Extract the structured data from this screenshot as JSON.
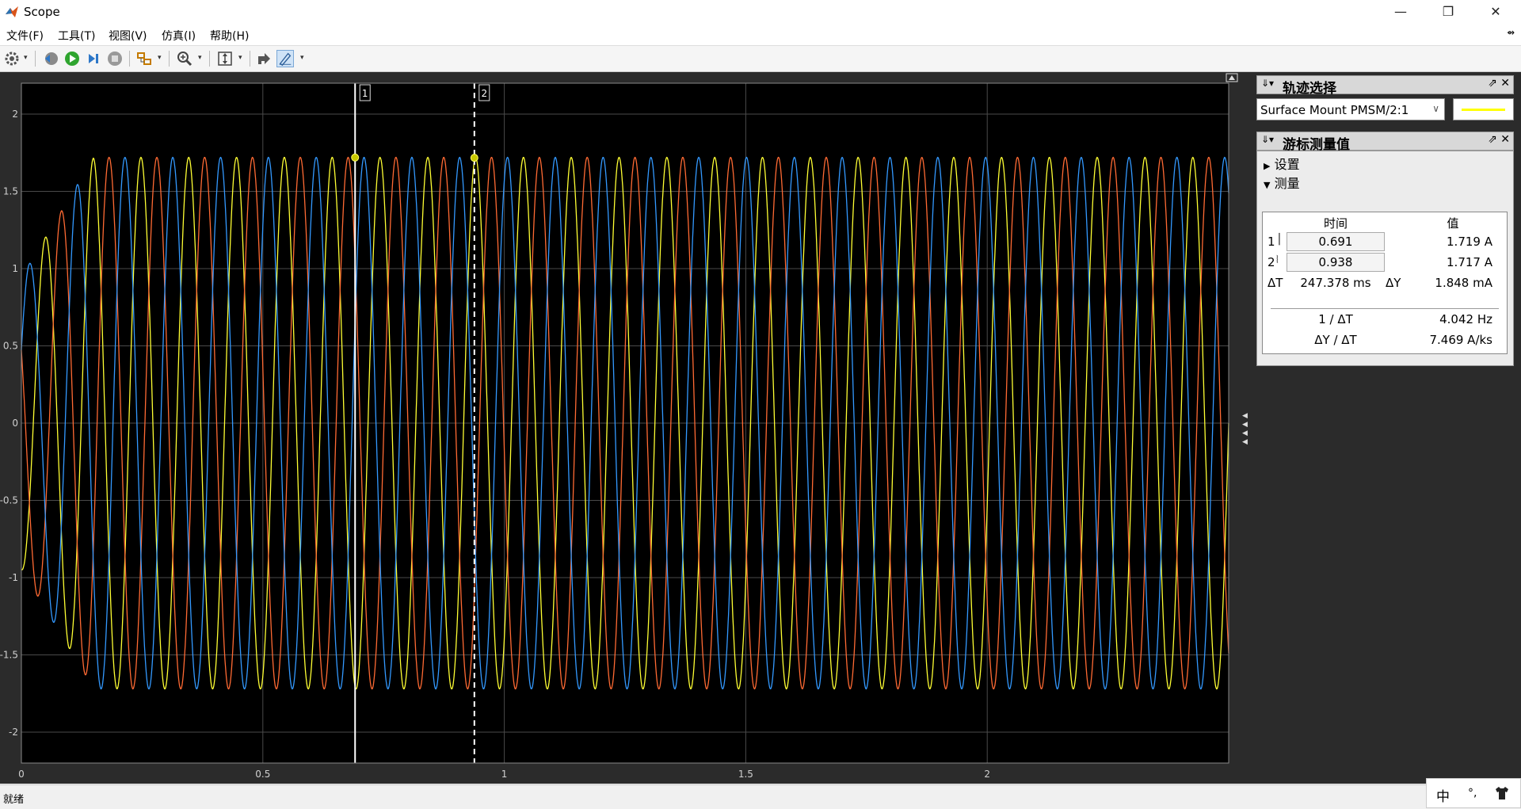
{
  "window": {
    "title": "Scope",
    "minimize_icon": "minimize-icon",
    "maximize_icon": "restore-icon",
    "close_icon": "close-icon"
  },
  "menu": [
    "文件(F)",
    "工具(T)",
    "视图(V)",
    "仿真(I)",
    "帮助(H)"
  ],
  "toolbar": [
    "settings-gear-icon",
    "step-back-icon",
    "run-icon",
    "step-forward-icon",
    "stop-icon",
    "highlight-block-icon",
    "zoom-icon",
    "scale-axes-icon",
    "bring-to-front-icon",
    "cursor-measurements-icon"
  ],
  "trace_panel": {
    "title": "轨迹选择",
    "selected_trace": "Surface Mount PMSM/2:1",
    "swatch_color": "#ffff00"
  },
  "cursor_panel": {
    "title": "游标测量值",
    "settings_label": "设置",
    "measure_label": "测量",
    "time_header": "时间",
    "value_header": "值",
    "rows": [
      {
        "id": "1",
        "time": "0.691",
        "value": "1.719 A"
      },
      {
        "id": "2",
        "time": "0.938",
        "value": "1.717 A"
      }
    ],
    "delta_t_label": "ΔT",
    "delta_t": "247.378 ms",
    "delta_y_label": "ΔY",
    "delta_y": "1.848 mA",
    "inv_dt_label": "1 / ΔT",
    "inv_dt": "4.042 Hz",
    "dydt_label": "ΔY / ΔT",
    "dydt": "7.469 A/ks"
  },
  "status": {
    "text": "就绪"
  },
  "ime": {
    "lang": "中",
    "punct": "°,",
    "skin": "shirt-icon"
  },
  "chart_data": {
    "type": "line",
    "xlim": [
      0,
      2.5
    ],
    "ylim": [
      -2.2,
      2.2
    ],
    "xticks": [
      "0",
      "0.5",
      "1",
      "1.5",
      "2"
    ],
    "yticks": [
      "2",
      "1.5",
      "1",
      "0.5",
      "0",
      "-0.5",
      "-1",
      "-1.5",
      "-2"
    ],
    "grid": true,
    "background": "#000000",
    "amplitude": 1.72,
    "frequency_hz": 10.1,
    "series": [
      {
        "color": "#ffff33",
        "phase_deg": -90
      },
      {
        "color": "#ff6a33",
        "phase_deg": 150
      },
      {
        "color": "#3399ff",
        "phase_deg": 30
      }
    ],
    "cursors": [
      {
        "label": "1",
        "x": 0.691,
        "y": 1.719,
        "style": "solid"
      },
      {
        "label": "2",
        "x": 0.938,
        "y": 1.717,
        "style": "dashed"
      }
    ]
  }
}
